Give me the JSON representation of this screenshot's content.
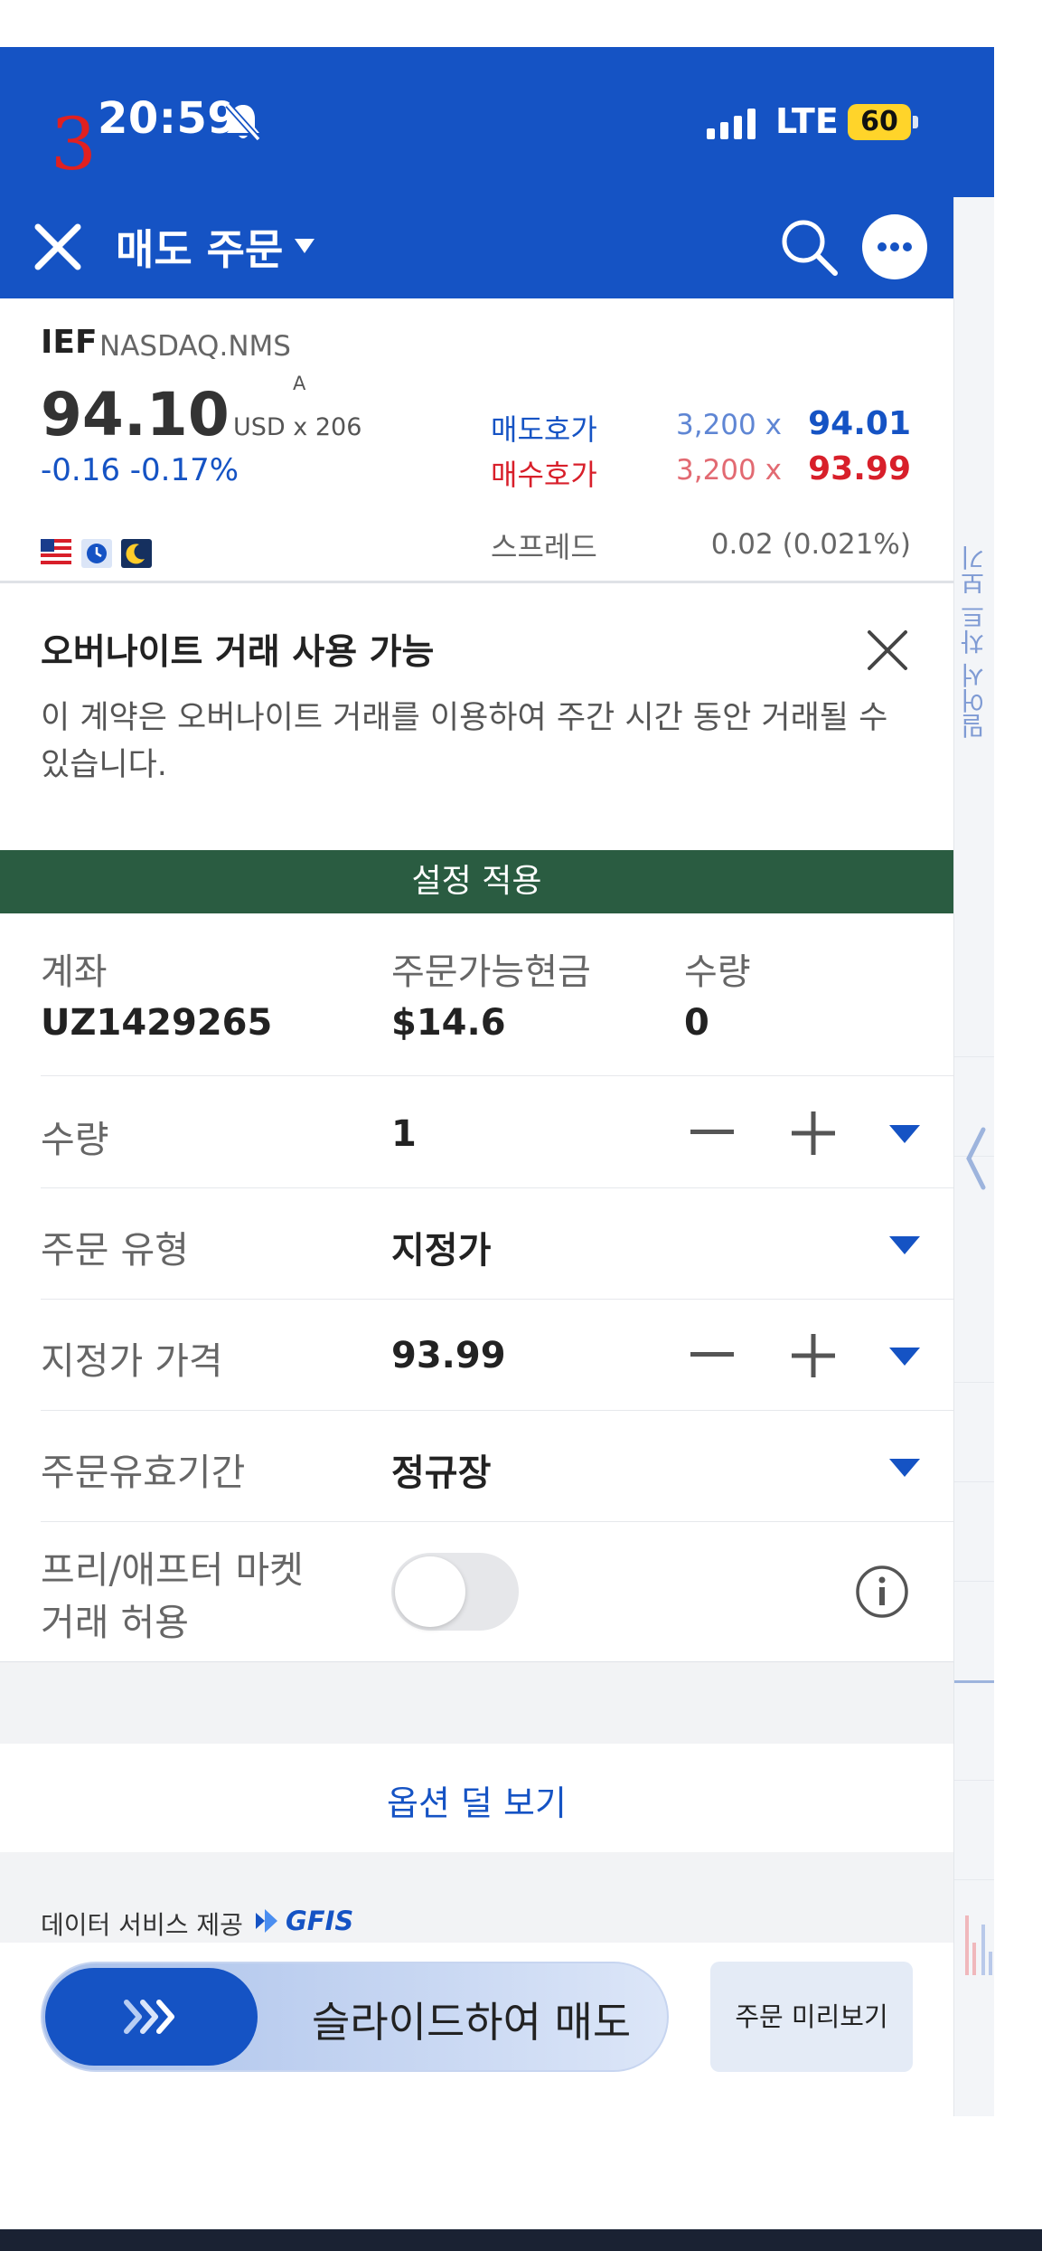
{
  "status_bar": {
    "time": "20:59",
    "network": "LTE",
    "battery": "60",
    "annotation_number": "3"
  },
  "nav": {
    "title": "매도 주문"
  },
  "quote": {
    "symbol": "IEF",
    "exchange": "NASDAQ.NMS",
    "price": "94.10",
    "currency_size": "USD x 206",
    "marker": "A",
    "change": "-0.16  -0.17%",
    "ask_label": "매도호가",
    "ask_size": "3,200 x",
    "ask_price": "94.01",
    "bid_label": "매수호가",
    "bid_size": "3,200 x",
    "bid_price": "93.99",
    "spread_label": "스프레드",
    "spread_value": "0.02 (0.021%)"
  },
  "side_panel": {
    "label": "밀어서 차트 보기"
  },
  "banner": {
    "title": "오버나이트 거래 사용 가능",
    "text": "이 계약은 오버나이트 거래를 이용하여 주간 시간 동안 거래될 수 있습니다."
  },
  "apply_settings": "설정 적용",
  "account": {
    "account_label": "계좌",
    "account_value": "UZ1429265",
    "cash_label": "주문가능현금",
    "cash_value": "$14.6",
    "qty_label": "수량",
    "qty_value": "0"
  },
  "rows": {
    "quantity_label": "수량",
    "quantity_value": "1",
    "order_type_label": "주문 유형",
    "order_type_value": "지정가",
    "limit_price_label": "지정가 가격",
    "limit_price_value": "93.99",
    "tif_label": "주문유효기간",
    "tif_value": "정규장",
    "ext_hours_label_1": "프리/애프터 마켓",
    "ext_hours_label_2": "거래 허용",
    "ext_hours_enabled": false
  },
  "less_options": "옵션 덜 보기",
  "credit": {
    "text": "데이터 서비스 제공",
    "brand": "GFIS"
  },
  "actions": {
    "slide_label": "슬라이드하여 매도",
    "preview_label": "주문 미리보기"
  },
  "colors": {
    "header": "#1553c4",
    "ask": "#1553c4",
    "bid": "#d81f2a",
    "apply_bar": "#2a5c41"
  }
}
